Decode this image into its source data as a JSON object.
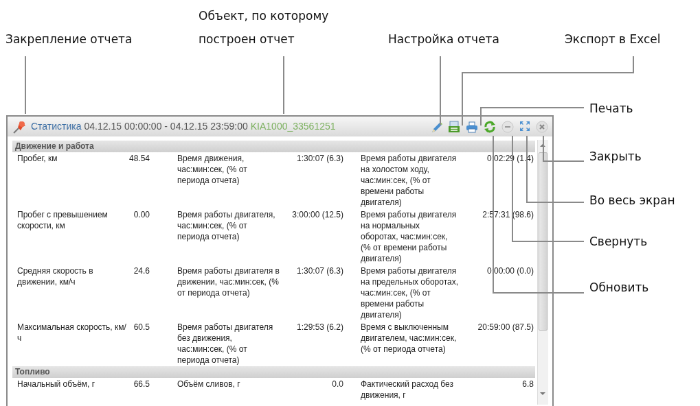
{
  "callouts": [
    {
      "text": "Закрепление отчета"
    },
    {
      "text": "Объект, по которому построен отчет"
    },
    {
      "text": "Настройка отчета"
    },
    {
      "text": "Экспорт в Excel"
    },
    {
      "text": "Печать"
    },
    {
      "text": "Закрыть"
    },
    {
      "text": "Во весь экран"
    },
    {
      "text": "Свернуть"
    },
    {
      "text": "Обновить"
    }
  ],
  "window": {
    "title": "Статистика",
    "period": "04.12.15 00:00:00 - 04.12.15 23:59:00",
    "object": "KIA1000_33561251"
  },
  "sections": [
    {
      "title": "Движение и работа",
      "rows": [
        {
          "cells": [
            "Пробег, км",
            "48.54",
            "Время движения, час:мин:сек, (% от периода отчета)",
            "1:30:07 (6.3)",
            "Время работы двигателя на холостом ходу, час:мин:сек, (% от времени работы двигателя)",
            "0:02:29 (1.4)"
          ]
        },
        {
          "cells": [
            "Пробег с превышением скорости, км",
            "0.00",
            "Время работы двигателя, час:мин:сек, (% от периода отчета)",
            "3:00:00 (12.5)",
            "Время работы двигателя на нормальных оборотах, час:мин:сек, (% от времени работы двигателя)",
            "2:57:31 (98.6)"
          ]
        },
        {
          "cells": [
            "Средняя скорость в движении, км/ч",
            "24.6",
            "Время работы двигателя в движении, час:мин:сек, (% от периода отчета)",
            "1:30:07 (6.3)",
            "Время работы двигателя на предельных оборотах, час:мин:сек, (% от времени работы двигателя)",
            "0:00:00 (0.0)"
          ]
        },
        {
          "cells": [
            "Максимальная скорость, км/ч",
            "60.5",
            "Время работы двигателя без движения, час:мин:сек, (% от периода отчета)",
            "1:29:53 (6.2)",
            "Время с выключенным двигателем, час:мин:сек, (% от периода отчета)",
            "20:59:00 (87.5)"
          ]
        }
      ]
    },
    {
      "title": "Топливо",
      "rows": [
        {
          "cells": [
            "Начальный объём, г",
            "66.5",
            "Объём сливов, г",
            "0.0",
            "Фактический расход без движения, г",
            "6.8"
          ]
        }
      ]
    }
  ]
}
